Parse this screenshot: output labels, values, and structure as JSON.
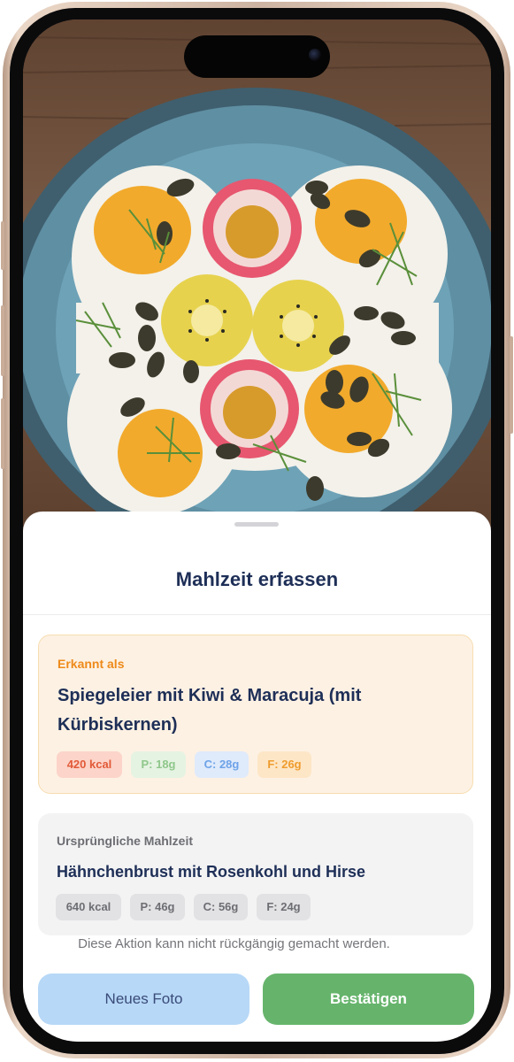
{
  "sheet": {
    "title": "Mahlzeit erfassen",
    "recognized": {
      "eyebrow": "Erkannt als",
      "meal": "Spiegeleier mit Kiwi & Maracuja (mit Kürbiskernen)",
      "kcal": "420 kcal",
      "protein": "P: 18g",
      "carbs": "C: 28g",
      "fat": "F: 26g"
    },
    "original": {
      "eyebrow": "Ursprüngliche Mahlzeit",
      "meal": "Hähnchenbrust mit Rosenkohl und Hirse",
      "kcal": "640 kcal",
      "protein": "P: 46g",
      "carbs": "C: 56g",
      "fat": "F: 24g"
    },
    "warning": "Diese Aktion kann nicht rückgängig gemacht werden.",
    "buttons": {
      "new_photo": "Neues Foto",
      "confirm": "Bestätigen"
    }
  },
  "colors": {
    "title": "#1e2f57",
    "accent_orange": "#ee8a1a",
    "confirm_green": "#66b46c",
    "new_photo_blue": "#b7d8f7"
  },
  "icons": [
    "dynamic-island",
    "front-camera",
    "food-photo"
  ]
}
